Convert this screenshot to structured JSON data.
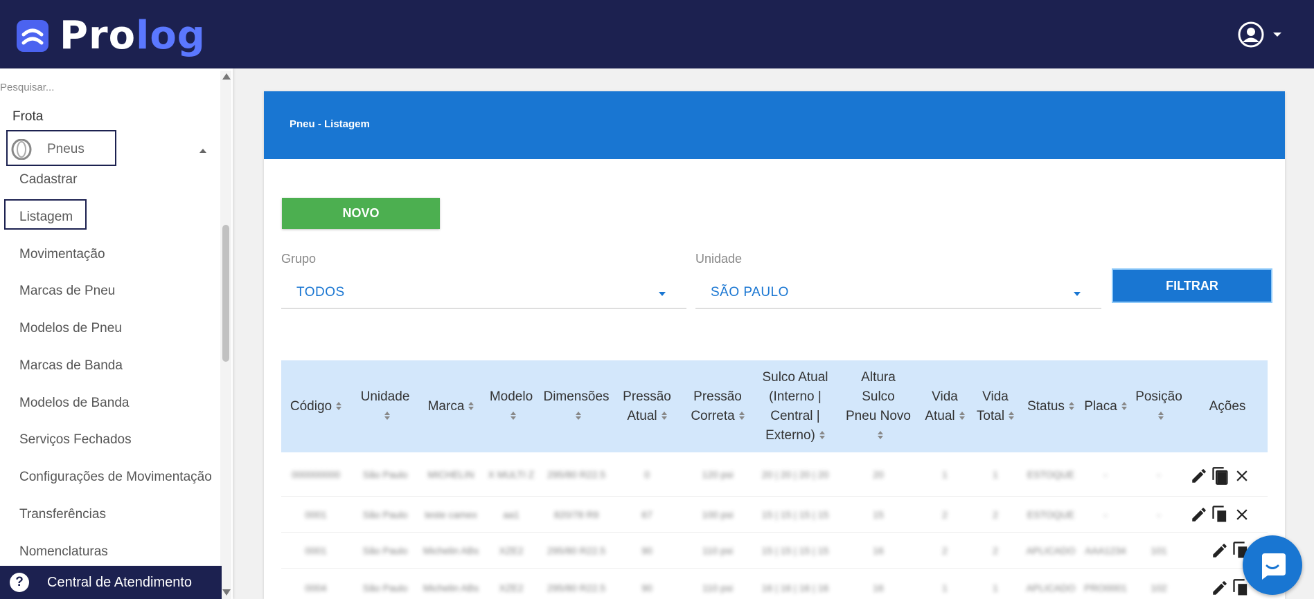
{
  "app": {
    "logo_part1": "Pro",
    "logo_part2": "log"
  },
  "sidebar": {
    "search_placeholder": "Pesquisar...",
    "section": "Frota",
    "group": "Pneus",
    "items": [
      "Cadastrar",
      "Listagem",
      "Movimentação",
      "Marcas de Pneu",
      "Modelos de Pneu",
      "Marcas de Banda",
      "Modelos de Banda",
      "Serviços Fechados",
      "Configurações de Movimentação",
      "Transferências",
      "Nomenclaturas"
    ],
    "help": "Central de Atendimento"
  },
  "page": {
    "title": "Pneu - Listagem",
    "new_button": "NOVO",
    "filter_button": "FILTRAR",
    "grupo_label": "Grupo",
    "grupo_value": "TODOS",
    "unidade_label": "Unidade",
    "unidade_value": "SÃO PAULO"
  },
  "table": {
    "columns": [
      {
        "l1": "Código",
        "l2": ""
      },
      {
        "l1": "Unidade",
        "l2": ""
      },
      {
        "l1": "Marca",
        "l2": ""
      },
      {
        "l1": "Modelo",
        "l2": ""
      },
      {
        "l1": "Dimensões",
        "l2": ""
      },
      {
        "l1": "Pressão",
        "l2": "Atual"
      },
      {
        "l1": "Pressão",
        "l2": "Correta"
      },
      {
        "l1": "Sulco Atual",
        "l2": "(Interno |",
        "l3": "Central |",
        "l4": "Externo)"
      },
      {
        "l1": "Altura",
        "l2": "Sulco",
        "l3": "Pneu Novo"
      },
      {
        "l1": "Vida",
        "l2": "Atual"
      },
      {
        "l1": "Vida",
        "l2": "Total"
      },
      {
        "l1": "Status",
        "l2": ""
      },
      {
        "l1": "Placa",
        "l2": ""
      },
      {
        "l1": "Posição",
        "l2": ""
      },
      {
        "l1": "Ações",
        "l2": ""
      }
    ],
    "rows": [
      [
        "000000000",
        "São Paulo",
        "MICHELIN",
        "X MULTI Z",
        "295/80 R22.5",
        "0",
        "120 psi",
        "20 | 20 | 20 | 20",
        "20",
        "1",
        "1",
        "ESTOQUE",
        "-",
        "-"
      ],
      [
        "0001",
        "São Paulo",
        "teste camex",
        "aa1",
        "820/78 R9",
        "67",
        "100 psi",
        "15 | 15 | 15 | 15",
        "15",
        "2",
        "2",
        "ESTOQUE",
        "-",
        "-"
      ],
      [
        "0001",
        "São Paulo",
        "Michelin ABs",
        "XZE2",
        "295/80 R22.5",
        "90",
        "110 psi",
        "15 | 15 | 15 | 15",
        "16",
        "2",
        "2",
        "APLICADO",
        "AAA1234",
        "101"
      ],
      [
        "0004",
        "São Paulo",
        "Michelin ABs",
        "XZE2",
        "295/80 R22.5",
        "90",
        "110 psi",
        "16 | 16 | 16 | 16",
        "16",
        "1",
        "1",
        "APLICADO",
        "PRO0001",
        "102"
      ]
    ]
  }
}
